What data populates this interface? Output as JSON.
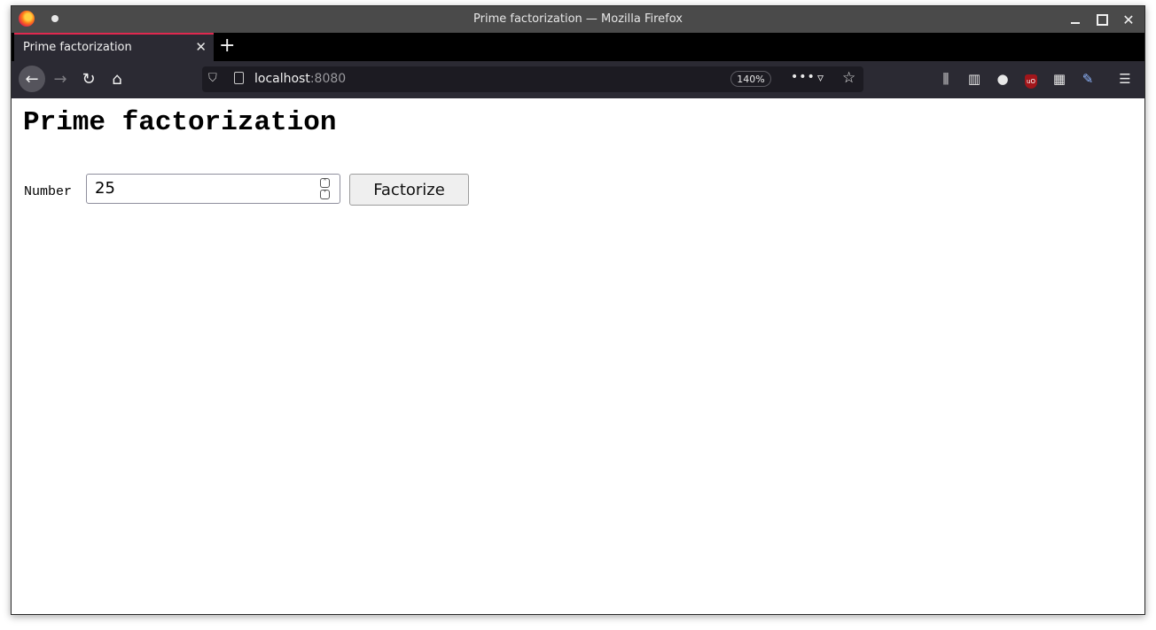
{
  "window": {
    "title": "Prime factorization — Mozilla Firefox"
  },
  "tabs": [
    {
      "label": "Prime factorization",
      "active": true
    }
  ],
  "navbar": {
    "url_host": "localhost",
    "url_port": ":8080",
    "zoom": "140%"
  },
  "page": {
    "heading": "Prime factorization",
    "number_label": "Number",
    "number_value": "25",
    "factorize_label": "Factorize"
  },
  "colors": {
    "tab_accent": "#e0284f",
    "chrome_dark": "#2b2a33"
  }
}
